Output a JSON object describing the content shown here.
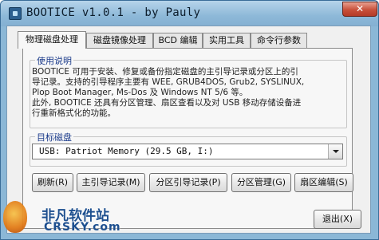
{
  "window": {
    "title": "BOOTICE v1.0.1 - by Pauly",
    "close_glyph": "✕"
  },
  "tabs": [
    {
      "label": "物理磁盘处理",
      "active": true
    },
    {
      "label": "磁盘镜像处理",
      "active": false
    },
    {
      "label": "BCD 编辑",
      "active": false
    },
    {
      "label": "实用工具",
      "active": false
    },
    {
      "label": "命令行参数",
      "active": false
    }
  ],
  "description": {
    "label": "使用说明",
    "text": "BOOTICE 可用于安装、修复或备份指定磁盘的主引导记录或分区上的引\n导记录。支持的引导程序主要有 WEE, GRUB4DOS, Grub2, SYSLINUX,\nPlop Boot Manager, Ms-Dos 及 Windows NT 5/6 等。\n此外, BOOTICE 还具有分区管理、扇区查看以及对 USB 移动存储设备进\n行重新格式化的功能。"
  },
  "target_disk": {
    "label": "目标磁盘",
    "selected": "USB:  Patriot Memory (29.5 GB, I:)"
  },
  "actions": {
    "refresh": "刷新(R)",
    "mbr": "主引导记录(M)",
    "pbr": "分区引导记录(P)",
    "parts": "分区管理(G)",
    "sector": "扇区编辑(S)",
    "exit": "退出(X)"
  },
  "watermark": {
    "name_cn": "非凡软件站",
    "name_en": "CRSKY.com"
  },
  "colors": {
    "title_bar": "#8db8d8",
    "close_button": "#c8503a",
    "group_label": "#1a3a8a"
  }
}
